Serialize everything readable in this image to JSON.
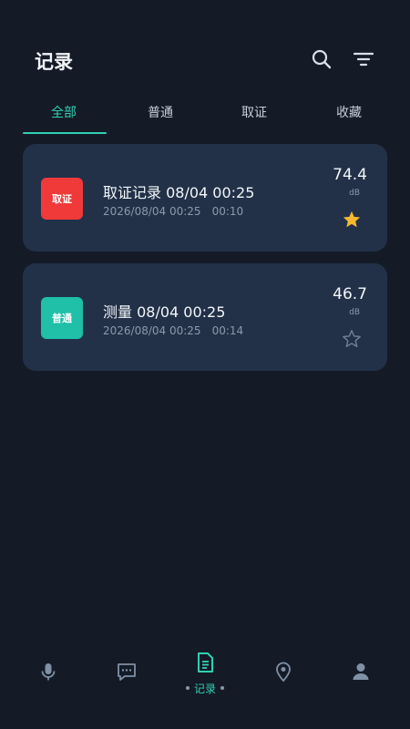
{
  "header": {
    "title": "记录"
  },
  "tabs": [
    {
      "label": "全部",
      "active": true
    },
    {
      "label": "普通",
      "active": false
    },
    {
      "label": "取证",
      "active": false
    },
    {
      "label": "收藏",
      "active": false
    }
  ],
  "records": [
    {
      "badge": "取证",
      "badge_color": "#f03a3a",
      "title": "取证记录 08/04 00:25",
      "date": "2026/08/04 00:25",
      "duration": "00:10",
      "value": "74.4",
      "unit": "dB",
      "starred": true
    },
    {
      "badge": "普通",
      "badge_color": "#1fbfa8",
      "title": "测量 08/04 00:25",
      "date": "2026/08/04 00:25",
      "duration": "00:14",
      "value": "46.7",
      "unit": "dB",
      "starred": false
    }
  ],
  "nav": {
    "items": [
      {
        "icon": "microphone-icon"
      },
      {
        "icon": "chat-icon"
      },
      {
        "icon": "document-icon",
        "label": "记录",
        "active": true
      },
      {
        "icon": "location-pin-icon"
      },
      {
        "icon": "person-icon"
      }
    ]
  },
  "colors": {
    "accent": "#32d0b2",
    "background": "#141b27",
    "card": "#223148",
    "star": "#f5b82e"
  }
}
